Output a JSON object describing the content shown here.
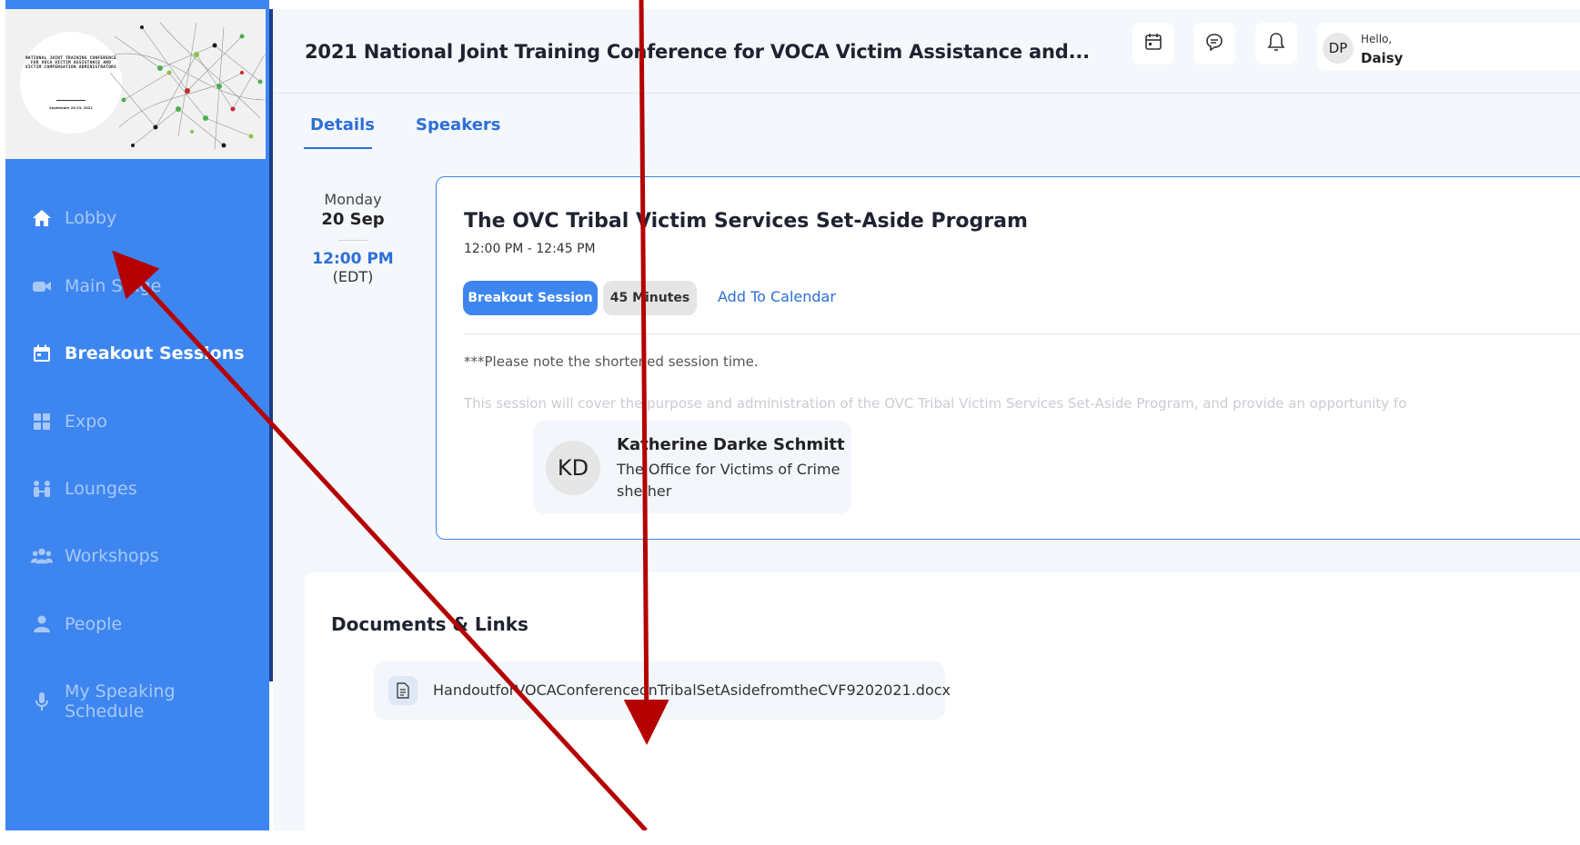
{
  "sidebar": {
    "banner": {
      "text": "NATIONAL JOINT TRAINING CONFERENCE FOR VOCA VICTIM ASSISTANCE AND VICTIM COMPENSATION ADMINISTRATORS",
      "date": "September 20-23, 2021"
    },
    "items": [
      {
        "label": "Lobby",
        "icon": "home-icon"
      },
      {
        "label": "Main Stage",
        "icon": "video-camera-icon"
      },
      {
        "label": "Breakout Sessions",
        "icon": "calendar-icon"
      },
      {
        "label": "Expo",
        "icon": "grid-icon"
      },
      {
        "label": "Lounges",
        "icon": "people-lounge-icon"
      },
      {
        "label": "Workshops",
        "icon": "group-icon"
      },
      {
        "label": "People",
        "icon": "person-icon"
      },
      {
        "label": "My Speaking Schedule",
        "icon": "microphone-icon"
      }
    ]
  },
  "header": {
    "title": "2021 National Joint Training Conference for VOCA Victim Assistance and...",
    "user": {
      "initials": "DP",
      "greeting": "Hello,",
      "name": "Daisy"
    }
  },
  "tabs": [
    {
      "label": "Details"
    },
    {
      "label": "Speakers"
    }
  ],
  "session": {
    "day_name": "Monday",
    "date": "20 Sep",
    "start_time": "12:00 PM",
    "timezone": "(EDT)",
    "title": "The OVC Tribal Victim Services Set-Aside Program",
    "time_range": "12:00 PM - 12:45 PM",
    "type_badge": "Breakout Session",
    "duration_badge": "45 Minutes",
    "add_to_calendar": "Add To Calendar",
    "note": "***Please note the shortened session time.",
    "description": "This session will cover the purpose and administration of the OVC Tribal Victim Services Set-Aside Program, and provide an opportunity fo",
    "speaker": {
      "initials": "KD",
      "name": "Katherine Darke Schmitt",
      "organization": "The Office for Victims of Crime",
      "pronouns": "she/her"
    }
  },
  "documents": {
    "title": "Documents & Links",
    "files": [
      {
        "name": "HandoutforVOCAConferenceonTribalSetAsidefromtheCVF9202021.docx",
        "icon": "document-icon"
      }
    ]
  },
  "colors": {
    "sidebar": "#3d86f0",
    "accent": "#2c6fd6",
    "annotation_arrow": "#b50000"
  }
}
